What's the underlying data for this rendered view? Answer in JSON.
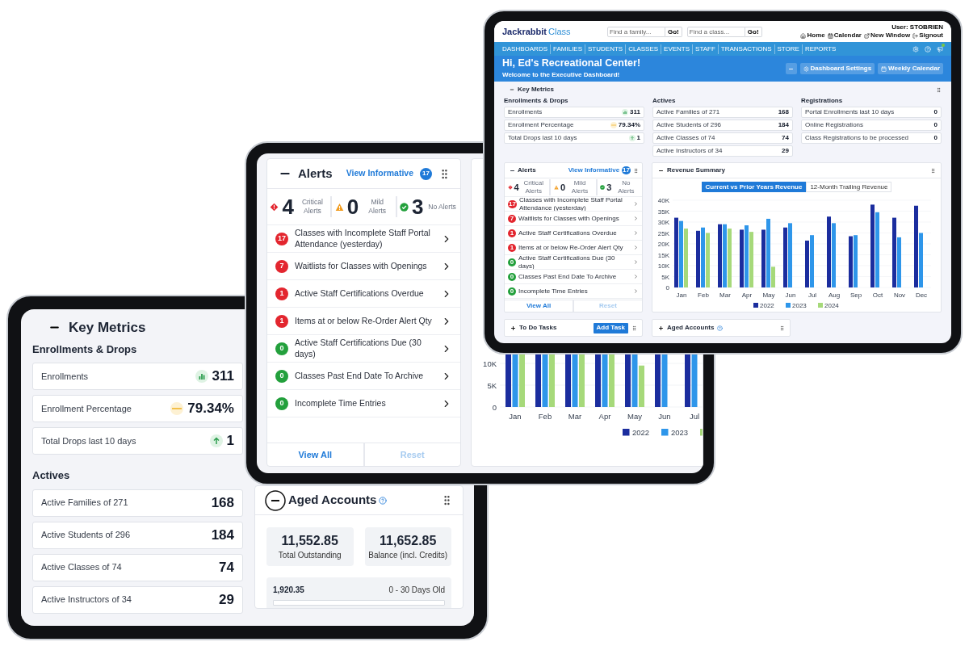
{
  "front_tablet": {
    "logo": {
      "name": "Jackrabbit",
      "product": "Class"
    },
    "search_fields": [
      {
        "placeholder": "Find a family...",
        "button": "Go!"
      },
      {
        "placeholder": "Find a class...",
        "button": "Go!"
      }
    ],
    "user": "User: STOBRIEN",
    "header_links": [
      {
        "kind": "home",
        "label": "Home"
      },
      {
        "kind": "calendar",
        "label": "Calendar"
      },
      {
        "kind": "window",
        "label": "New Window"
      },
      {
        "kind": "signout",
        "label": "Signout"
      }
    ],
    "nav": [
      "DASHBOARDS",
      "FAMILIES",
      "STUDENTS",
      "CLASSES",
      "EVENTS",
      "STAFF",
      "TRANSACTIONS",
      "STORE",
      "REPORTS"
    ],
    "greeting": "Hi, Ed's Recreational Center!",
    "subtitle": "Welcome to the Executive Dashboard!",
    "banner_buttons": [
      {
        "kind": "collapse"
      },
      {
        "kind": "settings",
        "label": "Dashboard Settings"
      },
      {
        "kind": "calendar",
        "label": "Weekly Calendar"
      }
    ],
    "key_metrics": {
      "title": "Key Metrics",
      "groups": [
        {
          "title": "Enrollments & Drops",
          "items": [
            {
              "label": "Enrollments",
              "value": "311",
              "kind": "chart"
            },
            {
              "label": "Enrollment Percentage",
              "value": "79.34%",
              "kind": "flat"
            },
            {
              "label": "Total Drops last 10 days",
              "value": "1",
              "kind": "up"
            }
          ]
        },
        {
          "title": "Actives",
          "items": [
            {
              "label": "Active Families of 271",
              "value": "168"
            },
            {
              "label": "Active Students of 296",
              "value": "184"
            },
            {
              "label": "Active Classes of 74",
              "value": "74"
            },
            {
              "label": "Active Instructors of 34",
              "value": "29"
            }
          ]
        },
        {
          "title": "Registrations",
          "items": [
            {
              "label": "Portal Enrollments last 10 days",
              "value": "0"
            },
            {
              "label": "Online Registrations",
              "value": "0"
            },
            {
              "label": "Class Registrations to be processed",
              "value": "0"
            }
          ]
        }
      ]
    },
    "alerts": {
      "title": "Alerts",
      "link": "View Informative",
      "link_count": "17",
      "summary": [
        {
          "kind": "critical",
          "count": "4",
          "label": "Critical Alerts"
        },
        {
          "kind": "mild",
          "count": "0",
          "label": "Mild Alerts"
        },
        {
          "kind": "none",
          "count": "3",
          "label": "No Alerts"
        }
      ],
      "items": [
        {
          "count": "17",
          "label": "Classes with Incomplete Staff Portal Attendance (yesterday)",
          "color": "#e3262f"
        },
        {
          "count": "7",
          "label": "Waitlists for Classes with Openings",
          "color": "#e3262f"
        },
        {
          "count": "1",
          "label": "Active Staff Certifications Overdue",
          "color": "#e3262f"
        },
        {
          "count": "1",
          "label": "Items at or below Re-Order Alert Qty",
          "color": "#e3262f"
        },
        {
          "count": "0",
          "label": "Active Staff Certifications Due (30 days)",
          "color": "#23a03c"
        },
        {
          "count": "0",
          "label": "Classes Past End Date To Archive",
          "color": "#23a03c"
        },
        {
          "count": "0",
          "label": "Incomplete Time Entries",
          "color": "#23a03c"
        }
      ],
      "footer": [
        {
          "label": "View All",
          "disabled": false
        },
        {
          "label": "Reset",
          "disabled": true
        }
      ]
    },
    "revenue": {
      "title": "Revenue Summary",
      "toggle": [
        {
          "label": "Current vs Prior Years Revenue",
          "selected": true
        },
        {
          "label": "12-Month Trailing Revenue",
          "selected": false
        }
      ],
      "chart_data": {
        "type": "bar",
        "categories": [
          "Jan",
          "Feb",
          "Mar",
          "Apr",
          "May",
          "Jun",
          "Jul",
          "Aug",
          "Sep",
          "Oct",
          "Nov",
          "Dec"
        ],
        "ylim": [
          0,
          40000
        ],
        "grid": true,
        "legend": "bottom",
        "yticks": [
          {
            "value": 0,
            "label": "0"
          },
          {
            "value": 5000,
            "label": "5K"
          },
          {
            "value": 10000,
            "label": "10K"
          },
          {
            "value": 15000,
            "label": "15K"
          },
          {
            "value": 20000,
            "label": "20K"
          },
          {
            "value": 25000,
            "label": "25K"
          },
          {
            "value": 30000,
            "label": "30K"
          },
          {
            "value": 35000,
            "label": "35K"
          },
          {
            "value": 40000,
            "label": "40K"
          }
        ],
        "series": [
          {
            "name": "2022",
            "color": "#1b2d9e",
            "values": [
              32000,
              26000,
              29000,
              26500,
              26500,
              27500,
              21500,
              32500,
              23500,
              38000,
              32000,
              37500
            ]
          },
          {
            "name": "2023",
            "color": "#2e96ea",
            "values": [
              30500,
              27500,
              29000,
              28500,
              31500,
              29500,
              24000,
              29500,
              24000,
              34500,
              23000,
              25000
            ]
          },
          {
            "name": "2024",
            "color": "#a6d97a",
            "values": [
              27000,
              25000,
              27000,
              25500,
              9500,
              null,
              null,
              null,
              null,
              null,
              null,
              null
            ]
          }
        ]
      }
    },
    "bottom_panels": [
      {
        "title": "To Do Tasks",
        "button": "Add Task",
        "help": false
      },
      {
        "title": "Aged Accounts",
        "help": true
      }
    ]
  },
  "middle_tablet": {
    "alerts": {
      "title": "Alerts",
      "link": "View Informative",
      "link_count": "17",
      "summary": [
        {
          "kind": "critical",
          "count": "4",
          "label": "Critical Alerts"
        },
        {
          "kind": "mild",
          "count": "0",
          "label": "Mild Alerts"
        },
        {
          "kind": "none",
          "count": "3",
          "label": "No Alerts"
        }
      ],
      "items": [
        {
          "count": "17",
          "label": "Classes with Incomplete Staff Portal Attendance (yesterday)",
          "color": "#e3262f"
        },
        {
          "count": "7",
          "label": "Waitlists for Classes with Openings",
          "color": "#e3262f"
        },
        {
          "count": "1",
          "label": "Active Staff Certifications Overdue",
          "color": "#e3262f"
        },
        {
          "count": "1",
          "label": "Items at or below Re-Order Alert Qty",
          "color": "#e3262f"
        },
        {
          "count": "0",
          "label": "Active Staff Certifications Due (30 days)",
          "color": "#23a03c"
        },
        {
          "count": "0",
          "label": "Classes Past End Date To Archive",
          "color": "#23a03c"
        },
        {
          "count": "0",
          "label": "Incomplete Time Entries",
          "color": "#23a03c"
        }
      ],
      "footer": [
        {
          "label": "View All",
          "disabled": false
        },
        {
          "label": "Reset",
          "disabled": true
        }
      ]
    },
    "revenue_chart": {
      "y_labels": [
        "10K",
        "5K",
        "0"
      ],
      "months": [
        "Jan",
        "Feb",
        "Mar",
        "Apr",
        "May",
        "Jun",
        "Jul"
      ],
      "legend": [
        {
          "label": "2022",
          "color": "#1b2d9e"
        },
        {
          "label": "2023",
          "color": "#2e96ea"
        },
        {
          "color": "#a6d97a"
        }
      ]
    }
  },
  "back_tablet": {
    "key_metrics": {
      "title": "Key Metrics",
      "groups": [
        {
          "title": "Enrollments & Drops",
          "items": [
            {
              "label": "Enrollments",
              "value": "311",
              "kind": "chart"
            },
            {
              "label": "Enrollment Percentage",
              "value": "79.34%",
              "kind": "flat"
            },
            {
              "label": "Total Drops last 10 days",
              "value": "1",
              "kind": "up"
            }
          ]
        },
        {
          "title": "Actives",
          "items": [
            {
              "label": "Active Families of 271",
              "value": "168"
            },
            {
              "label": "Active Students of 296",
              "value": "184"
            },
            {
              "label": "Active Classes of 74",
              "value": "74"
            },
            {
              "label": "Active Instructors of 34",
              "value": "29"
            }
          ]
        }
      ]
    },
    "aged_accounts": {
      "title": "Aged Accounts",
      "totals": [
        {
          "value": "11,552.85",
          "label": "Total Outstanding"
        },
        {
          "value": "11,652.85",
          "label": "Balance (incl. Credits)"
        }
      ],
      "buckets": [
        {
          "amount": "1,920.35",
          "label": "0 - 30 Days Old"
        }
      ]
    }
  }
}
